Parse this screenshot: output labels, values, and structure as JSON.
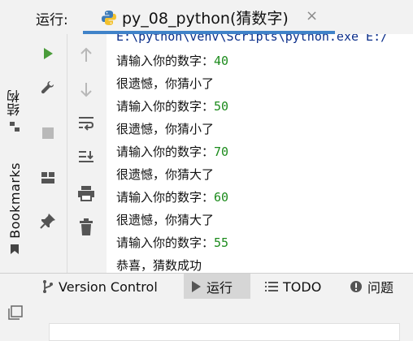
{
  "window": {
    "run_label": "运行:",
    "tab_title": "py_08_python(猜数字)",
    "tab_close": "×"
  },
  "left_strip": {
    "structure_tab": "结构",
    "bookmarks_tab": "Bookmarks"
  },
  "console": {
    "lines": [
      {
        "type": "cmd",
        "text": "E:\\python\\venv\\Scripts\\python.exe E:/"
      },
      {
        "type": "prompt",
        "text": "请输入你的数字：",
        "input": "40"
      },
      {
        "type": "output",
        "text": "很遗憾，你猜小了"
      },
      {
        "type": "prompt",
        "text": "请输入你的数字：",
        "input": "50"
      },
      {
        "type": "output",
        "text": "很遗憾，你猜小了"
      },
      {
        "type": "prompt",
        "text": "请输入你的数字：",
        "input": "70"
      },
      {
        "type": "output",
        "text": "很遗憾，你猜大了"
      },
      {
        "type": "prompt",
        "text": "请输入你的数字：",
        "input": "60"
      },
      {
        "type": "output",
        "text": "很遗憾，你猜大了"
      },
      {
        "type": "prompt",
        "text": "请输入你的数字：",
        "input": "55"
      },
      {
        "type": "output",
        "text": "恭喜，猜数成功"
      }
    ]
  },
  "bottom_tabs": {
    "version_control": "Version Control",
    "run": "运行",
    "todo": "TODO",
    "problems": "问题"
  },
  "colors": {
    "accent": "#4083c9",
    "run_green": "#4a9c3a",
    "input_green": "#1c8b1c",
    "cmd_blue": "#0b2e8a"
  },
  "icons": [
    "python-icon",
    "close-icon",
    "structure-icon",
    "bookmark-icon",
    "run-icon",
    "wrench-icon",
    "stop-icon",
    "layout-icon",
    "pin-icon",
    "arrow-up-icon",
    "arrow-down-icon",
    "soft-wrap-icon",
    "scroll-to-end-icon",
    "print-icon",
    "trash-icon",
    "branch-icon",
    "list-icon",
    "problems-icon",
    "window-icon"
  ]
}
